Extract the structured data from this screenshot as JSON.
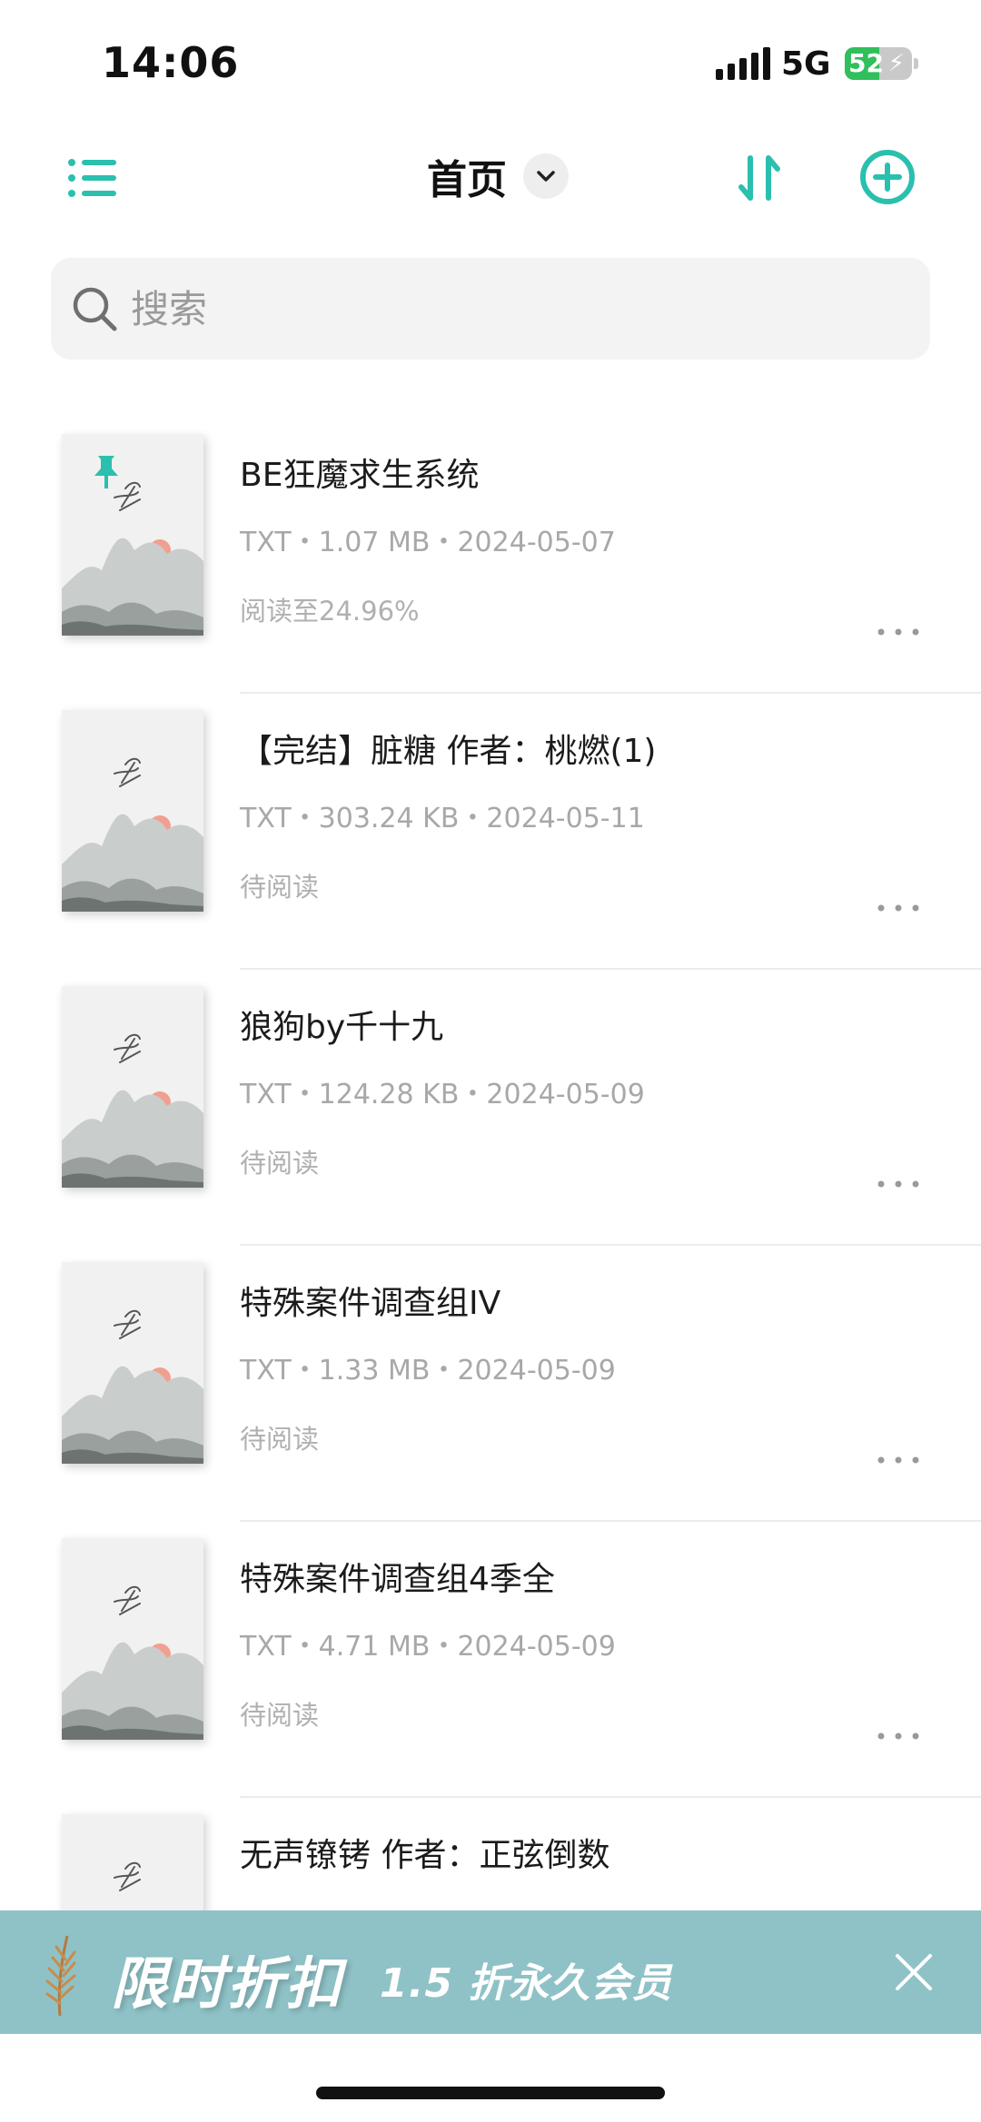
{
  "status_bar": {
    "time": "14:06",
    "network": "5G",
    "battery_percent": "52",
    "battery_level": 0.52,
    "charging": true
  },
  "header": {
    "title": "首页",
    "menu_icon": "list-menu-icon",
    "dropdown_icon": "chevron-down-icon",
    "sort_icon": "sort-arrows-icon",
    "add_icon": "plus-circle-icon"
  },
  "search": {
    "placeholder": "搜索",
    "icon": "search-icon"
  },
  "books": [
    {
      "title": "BE狂魔求生系统",
      "format": "TXT",
      "size": "1.07 MB",
      "date": "2024-05-07",
      "meta": "TXT・1.07 MB・2024-05-07",
      "status": "阅读至24.96%",
      "pinned": true
    },
    {
      "title": "【完结】脏糖 作者：桃燃(1)",
      "format": "TXT",
      "size": "303.24 KB",
      "date": "2024-05-11",
      "meta": "TXT・303.24 KB・2024-05-11",
      "status": "待阅读",
      "pinned": false
    },
    {
      "title": "狼狗by千十九",
      "format": "TXT",
      "size": "124.28 KB",
      "date": "2024-05-09",
      "meta": "TXT・124.28 KB・2024-05-09",
      "status": "待阅读",
      "pinned": false
    },
    {
      "title": "特殊案件调查组IV",
      "format": "TXT",
      "size": "1.33 MB",
      "date": "2024-05-09",
      "meta": "TXT・1.33 MB・2024-05-09",
      "status": "待阅读",
      "pinned": false
    },
    {
      "title": "特殊案件调查组4季全",
      "format": "TXT",
      "size": "4.71 MB",
      "date": "2024-05-09",
      "meta": "TXT・4.71 MB・2024-05-09",
      "status": "待阅读",
      "pinned": false
    },
    {
      "title": "无声镣铐 作者：正弦倒数",
      "format": "",
      "size": "",
      "date": "",
      "meta": "",
      "status": "",
      "pinned": false
    }
  ],
  "promo": {
    "title": "限时折扣",
    "subtitle": "1.5 折永久会员",
    "close_icon": "close-icon"
  },
  "colors": {
    "accent": "#2bbfae",
    "promo_bg": "#8ec2c7",
    "cover_sun": "#f0a090"
  }
}
